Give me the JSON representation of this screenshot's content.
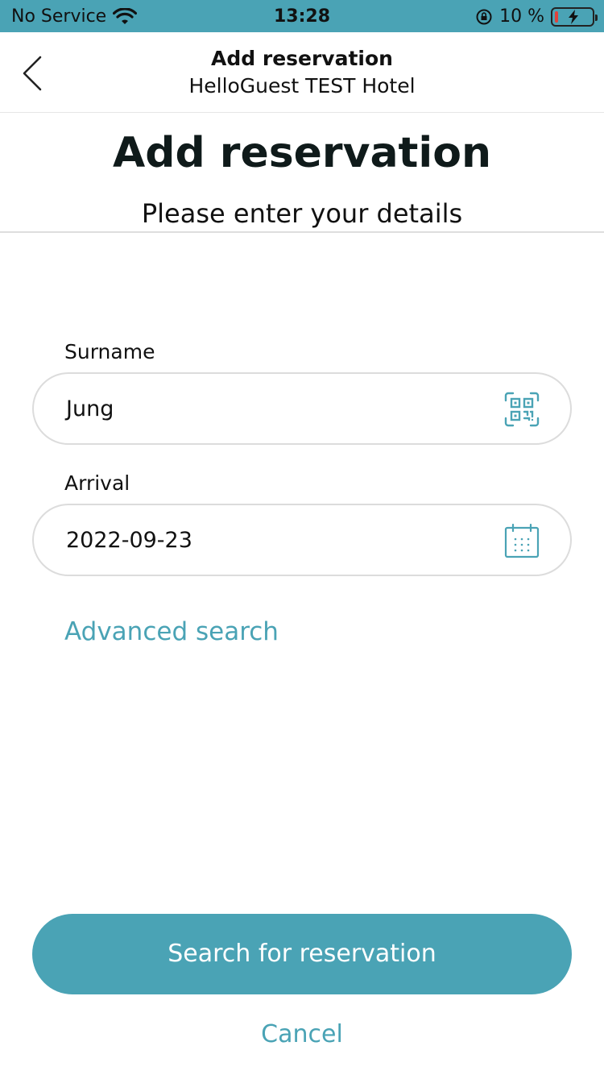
{
  "status_bar": {
    "carrier": "No Service",
    "time": "13:28",
    "battery_text": "10 %",
    "battery_level": 0.1,
    "wifi_icon": "wifi-icon",
    "rotation_lock_icon": "rotation-lock-icon"
  },
  "nav": {
    "title": "Add reservation",
    "subtitle": "HelloGuest TEST Hotel",
    "back_icon": "chevron-left-icon"
  },
  "header": {
    "title": "Add reservation",
    "subtitle": "Please enter your details"
  },
  "form": {
    "surname_label": "Surname",
    "surname_value": "Jung",
    "surname_icon": "qr-code-icon",
    "arrival_label": "Arrival",
    "arrival_value": "2022-09-23",
    "arrival_icon": "calendar-icon"
  },
  "links": {
    "advanced_search": "Advanced search",
    "cancel": "Cancel"
  },
  "actions": {
    "search_button": "Search for reservation"
  },
  "colors": {
    "accent": "#4aa3b5",
    "battery_low": "#e0423a"
  }
}
